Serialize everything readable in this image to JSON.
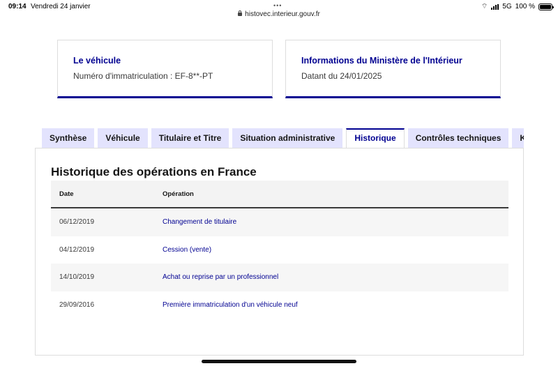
{
  "status_bar": {
    "time": "09:14",
    "date": "Vendredi 24 janvier",
    "url": "histovec.interieur.gouv.fr",
    "network": "5G",
    "battery": "100 %",
    "battery_level": 1.0,
    "icons": [
      "wifi-icon",
      "signal-icon",
      "battery-icon",
      "lock-icon"
    ]
  },
  "cards": {
    "vehicle": {
      "title": "Le véhicule",
      "text": "Numéro d'immatriculation : EF-8**-PT"
    },
    "ministere": {
      "title": "Informations du Ministère de l'Intérieur",
      "text": "Datant du 24/01/2025"
    }
  },
  "tabs": [
    {
      "label": "Synthèse",
      "active": false
    },
    {
      "label": "Véhicule",
      "active": false
    },
    {
      "label": "Titulaire et Titre",
      "active": false
    },
    {
      "label": "Situation administrative",
      "active": false
    },
    {
      "label": "Historique",
      "active": true
    },
    {
      "label": "Contrôles techniques",
      "active": false
    },
    {
      "label": "Kilométrage",
      "active": false
    }
  ],
  "panel": {
    "title": "Historique des opérations en France",
    "columns": {
      "date": "Date",
      "operation": "Opération"
    },
    "rows": [
      {
        "date": "06/12/2019",
        "operation": "Changement de titulaire"
      },
      {
        "date": "04/12/2019",
        "operation": "Cession (vente)"
      },
      {
        "date": "14/10/2019",
        "operation": "Achat ou reprise par un professionnel"
      },
      {
        "date": "29/09/2016",
        "operation": "Première immatriculation d'un véhicule neuf"
      }
    ]
  },
  "colors": {
    "accent": "#000091",
    "tab_background": "#e3e3fd",
    "row_stripe": "#f6f6f6"
  }
}
